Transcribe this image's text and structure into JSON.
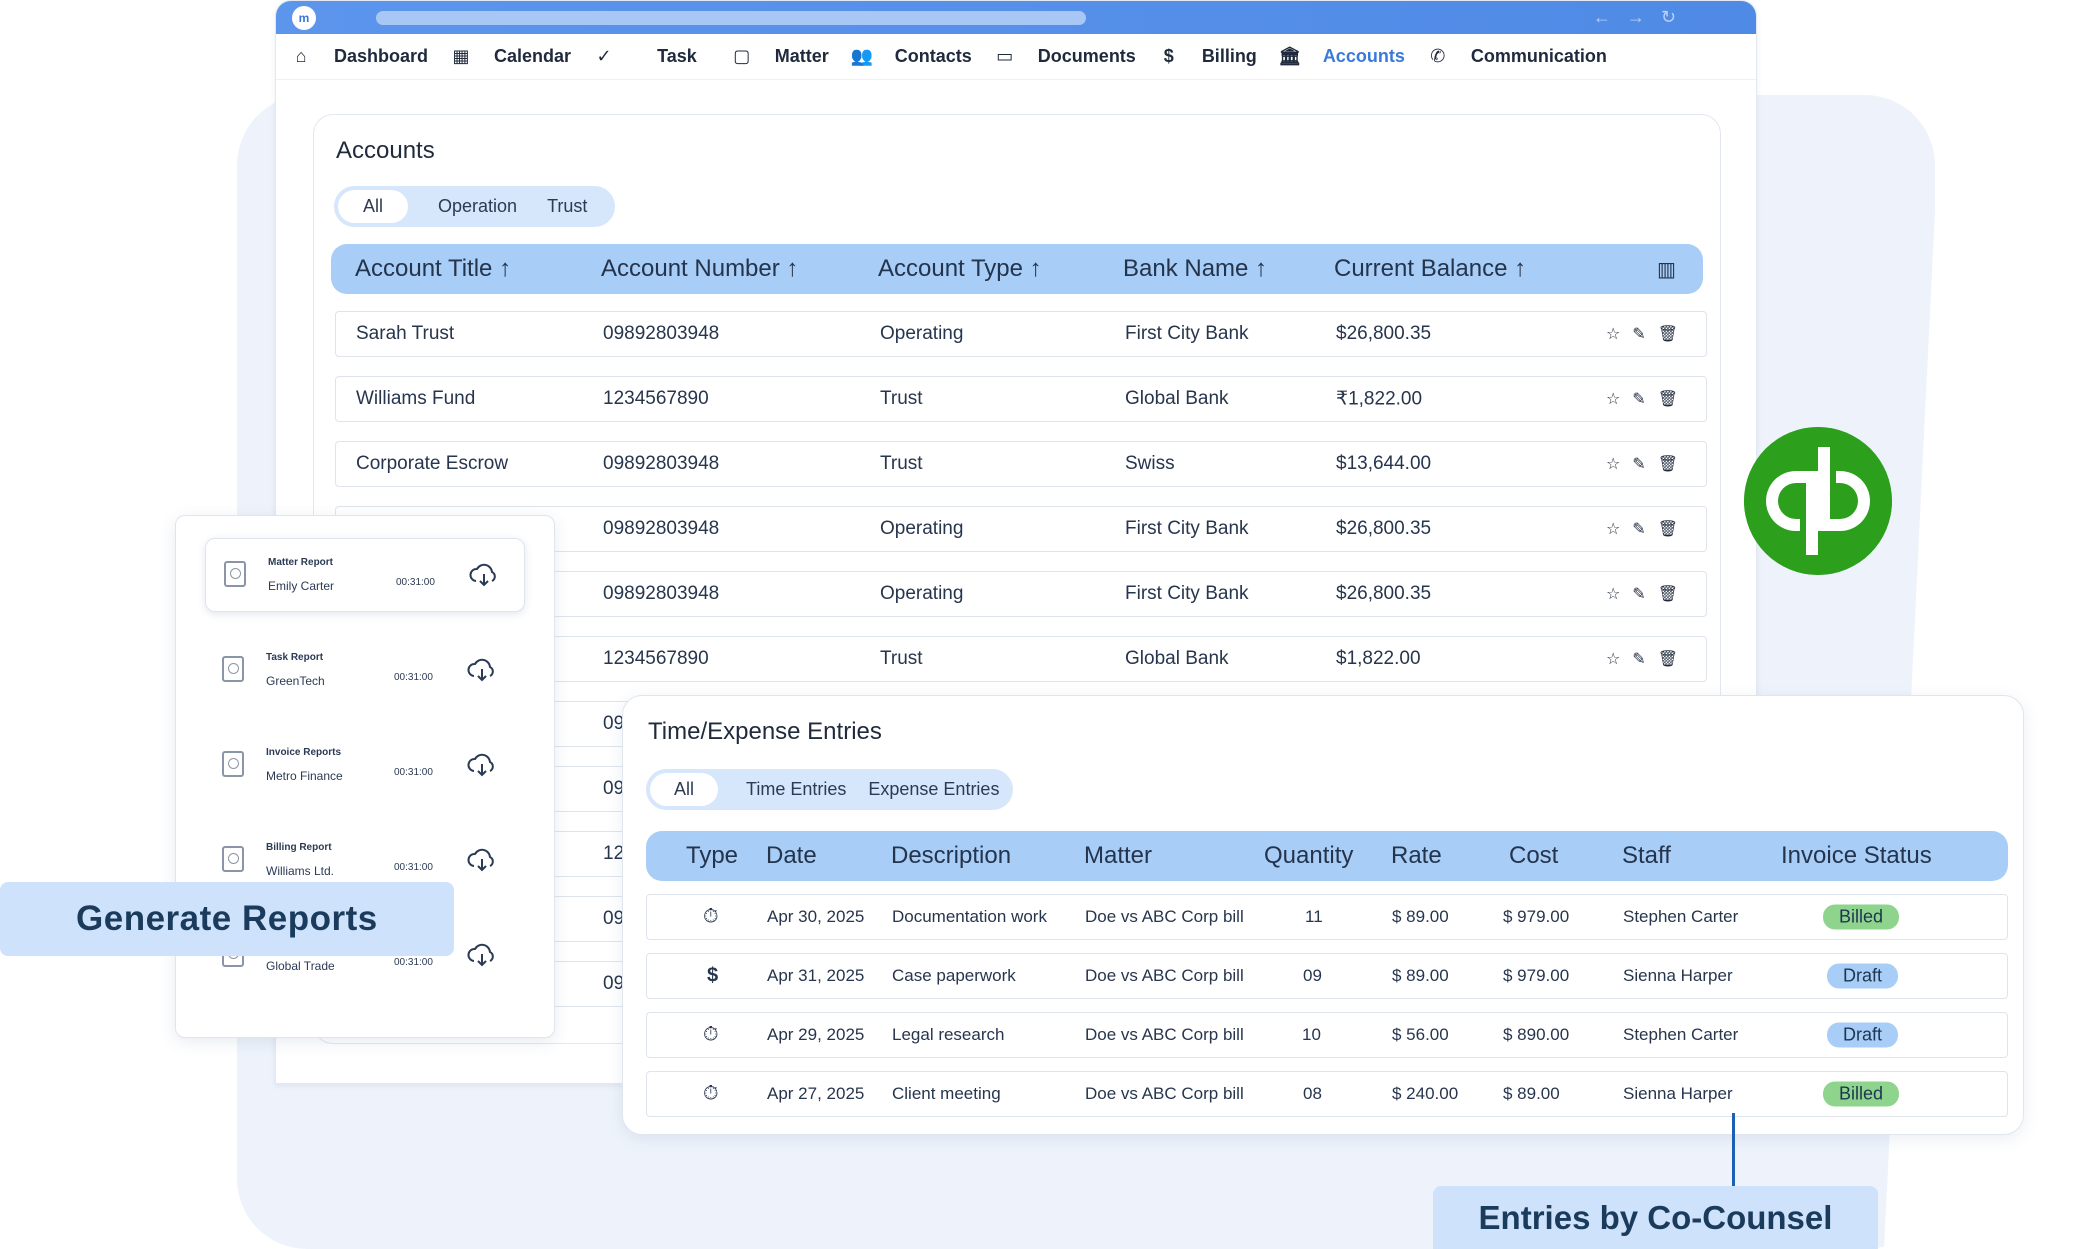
{
  "nav": [
    {
      "label": "Dashboard",
      "icon": "home-icon"
    },
    {
      "label": "Calendar",
      "icon": "calendar-icon"
    },
    {
      "label": "Task",
      "icon": "task-check-icon"
    },
    {
      "label": "Matter",
      "icon": "briefcase-icon"
    },
    {
      "label": "Contacts",
      "icon": "people-icon"
    },
    {
      "label": "Documents",
      "icon": "folder-icon"
    },
    {
      "label": "Billing",
      "icon": "dollar-icon"
    },
    {
      "label": "Accounts",
      "icon": "bank-icon",
      "active": true
    },
    {
      "label": "Communication",
      "icon": "phone-icon"
    }
  ],
  "accounts": {
    "title": "Accounts",
    "filters": [
      "All",
      "Operation",
      "Trust"
    ],
    "selected_filter": "All",
    "columns": [
      "Account Title ↑",
      "Account Number ↑",
      "Account Type ↑",
      "Bank Name ↑",
      "Current Balance ↑"
    ],
    "rows": [
      [
        "Sarah Trust",
        "09892803948",
        "Operating",
        "First City Bank",
        "$26,800.35"
      ],
      [
        "Williams Fund",
        "1234567890",
        "Trust",
        "Global Bank",
        "₹1,822.00"
      ],
      [
        "Corporate Escrow",
        "09892803948",
        "Trust",
        "Swiss",
        "$13,644.00"
      ],
      [
        "",
        "09892803948",
        "Operating",
        "First City Bank",
        "$26,800.35"
      ],
      [
        "",
        "09892803948",
        "Operating",
        "First City Bank",
        "$26,800.35"
      ],
      [
        "",
        "1234567890",
        "Trust",
        "Global Bank",
        "$1,822.00"
      ]
    ],
    "partial_numbers": [
      "09",
      "09",
      "12",
      "09",
      "09"
    ]
  },
  "reports": [
    {
      "name": "Matter Report",
      "client": "Emily Carter",
      "time": "00:31:00"
    },
    {
      "name": "Task Report",
      "client": "GreenTech",
      "time": "00:31:00"
    },
    {
      "name": "Invoice Reports",
      "client": "Metro Finance",
      "time": "00:31:00"
    },
    {
      "name": "Billing Report",
      "client": "Williams Ltd.",
      "time": "00:31:00"
    },
    {
      "name": "",
      "client": "Global Trade",
      "time": "00:31:00"
    }
  ],
  "generate_reports_label": "Generate Reports",
  "time_expense": {
    "title": "Time/Expense Entries",
    "filters": [
      "All",
      "Time Entries",
      "Expense Entries"
    ],
    "selected_filter": "All",
    "columns": [
      "Type",
      "Date",
      "Description",
      "Matter",
      "Quantity",
      "Rate",
      "Cost",
      "Staff",
      "Invoice Status"
    ],
    "rows": [
      {
        "type": "timer-icon",
        "date": "Apr 30, 2025",
        "description": "Documentation work",
        "matter": "Doe vs ABC Corp bill",
        "quantity": "11",
        "rate": "$ 89.00",
        "cost": "$ 979.00",
        "staff": "Stephen Carter",
        "status": "Billed"
      },
      {
        "type": "dollar-icon",
        "date": "Apr 31, 2025",
        "description": "Case paperwork",
        "matter": "Doe vs ABC Corp bill",
        "quantity": "09",
        "rate": "$ 89.00",
        "cost": "$ 979.00",
        "staff": "Sienna Harper",
        "status": "Draft"
      },
      {
        "type": "timer-icon",
        "date": "Apr 29, 2025",
        "description": "Legal research",
        "matter": "Doe vs ABC Corp bill",
        "quantity": "10",
        "rate": "$ 56.00",
        "cost": "$ 890.00",
        "staff": "Stephen Carter",
        "status": "Draft"
      },
      {
        "type": "timer-icon",
        "date": "Apr 27, 2025",
        "description": "Client meeting",
        "matter": "Doe vs ABC Corp bill",
        "quantity": "08",
        "rate": "$ 240.00",
        "cost": "$ 89.00",
        "staff": "Sienna Harper",
        "status": "Billed"
      }
    ]
  },
  "entries_label": "Entries by Co-Counsel",
  "colors": {
    "accent": "#3a7ad9",
    "quickbooks": "#2ca01c",
    "billed": "#8fd48c",
    "draft": "#a8cdf6"
  }
}
